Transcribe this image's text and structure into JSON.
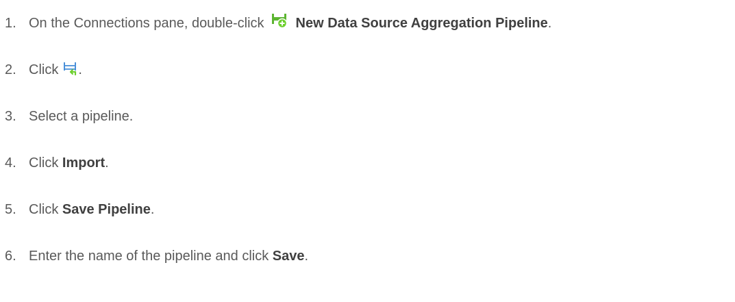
{
  "steps": [
    {
      "number": "1.",
      "text": "On the Connections pane, double-click",
      "icon": "new-data-source-aggregation-pipeline-icon",
      "bold": "New Data Source Aggregation Pipeline",
      "suffix": "."
    },
    {
      "number": "2.",
      "text": "Click",
      "icon": "import-pipeline-icon",
      "suffix": "."
    },
    {
      "number": "3.",
      "text": "Select a pipeline."
    },
    {
      "number": "4.",
      "text": "Click",
      "bold": "Import",
      "suffix": "."
    },
    {
      "number": "5.",
      "text": "Click",
      "bold": "Save Pipeline",
      "suffix": "."
    },
    {
      "number": "6.",
      "text": "Enter the name of the pipeline and click",
      "bold": "Save",
      "suffix": "."
    }
  ],
  "colors": {
    "text": "#595959",
    "bold_text": "#404040",
    "pipeline_green": "#5cb531",
    "plus_badge_green": "#6dcf2e",
    "import_blue": "#4a90d9"
  }
}
